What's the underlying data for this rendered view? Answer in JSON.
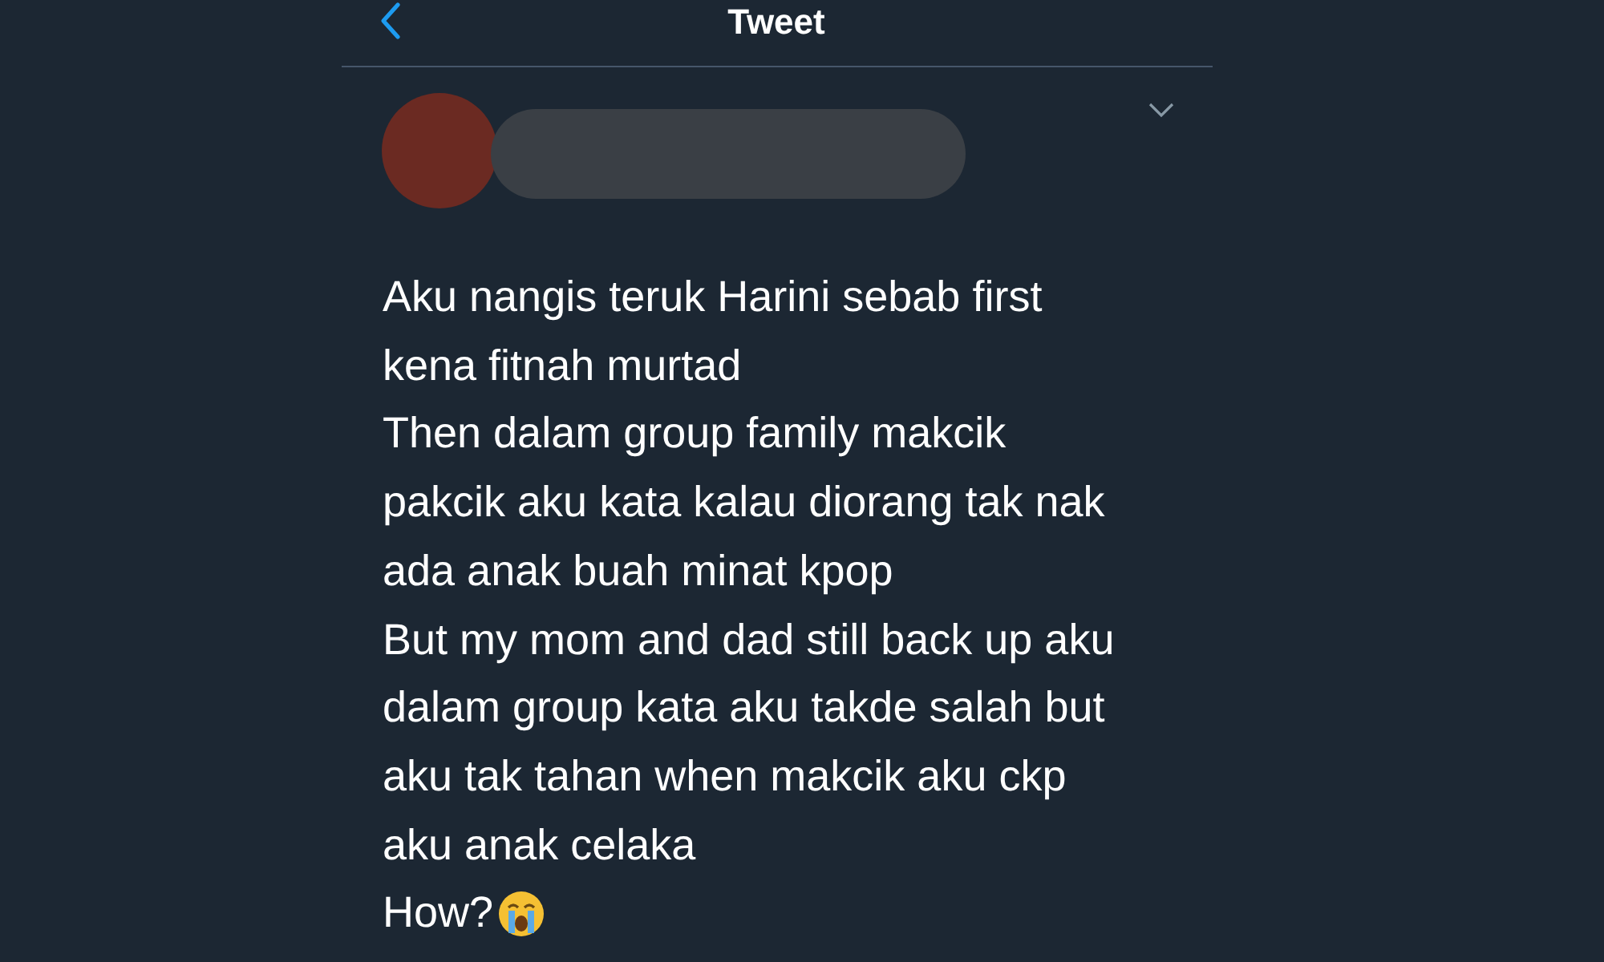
{
  "header": {
    "title": "Tweet"
  },
  "tweet": {
    "lines": [
      "Aku nangis teruk Harini sebab first",
      "kena fitnah murtad",
      "Then dalam group family makcik",
      "pakcik aku kata kalau diorang tak nak",
      "ada anak buah minat kpop",
      "But my mom and dad still back up aku",
      "dalam group kata aku takde salah but",
      "aku tak tahan when makcik aku ckp",
      "aku anak celaka",
      "How?"
    ]
  }
}
